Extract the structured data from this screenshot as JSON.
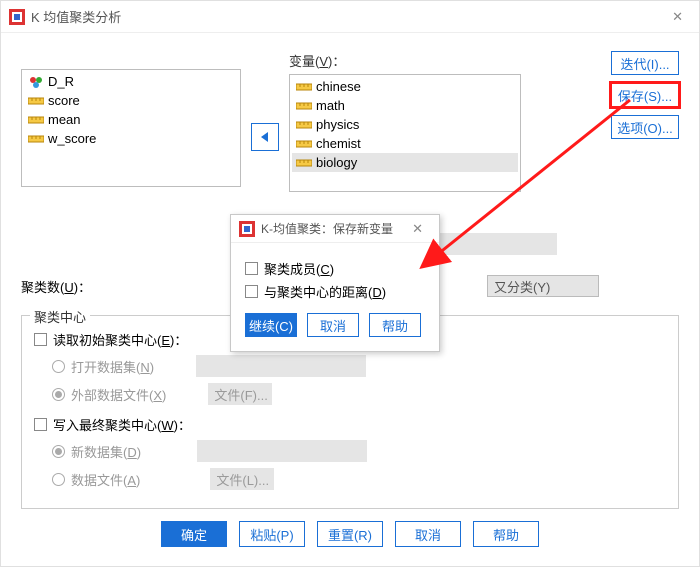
{
  "window": {
    "title": "K 均值聚类分析"
  },
  "labels": {
    "variables": "变量",
    "variables_u": "V",
    "cluster_count": "聚类数",
    "cluster_count_u": "U",
    "cluster_center": "聚类中心"
  },
  "source_vars": [
    {
      "name": "D_R",
      "icon": "nominal"
    },
    {
      "name": "score",
      "icon": "scale"
    },
    {
      "name": "mean",
      "icon": "scale"
    },
    {
      "name": "w_score",
      "icon": "scale"
    }
  ],
  "target_vars": [
    {
      "name": "chinese",
      "selected": false
    },
    {
      "name": "math",
      "selected": false
    },
    {
      "name": "physics",
      "selected": false
    },
    {
      "name": "chemist",
      "selected": false
    },
    {
      "name": "biology",
      "selected": true
    }
  ],
  "side_buttons": {
    "iterate": "迭代(I)...",
    "save": "保存(S)...",
    "options": "选项(O)..."
  },
  "method_btn": "又分类(Y)",
  "center_group": {
    "read": {
      "label": "读取初始聚类中心",
      "u": "E"
    },
    "open_dataset": {
      "label": "打开数据集",
      "u": "N"
    },
    "external_file": {
      "label": "外部数据文件",
      "u": "X"
    },
    "write": {
      "label": "写入最终聚类中心",
      "u": "W"
    },
    "new_dataset": {
      "label": "新数据集",
      "u": "D"
    },
    "data_file": {
      "label": "数据文件",
      "u": "A"
    },
    "file_btn_f": "文件(F)...",
    "file_btn_l": "文件(L)..."
  },
  "bottom": {
    "ok": "确定",
    "paste": "粘贴(P)",
    "reset": "重置(R)",
    "cancel": "取消",
    "help": "帮助"
  },
  "modal": {
    "title": "K-均值聚类：保存新变量",
    "membership": {
      "label": "聚类成员",
      "u": "C"
    },
    "distance": {
      "label": "与聚类中心的距离",
      "u": "D"
    },
    "continue": "继续(C)",
    "cancel": "取消",
    "help": "帮助"
  }
}
